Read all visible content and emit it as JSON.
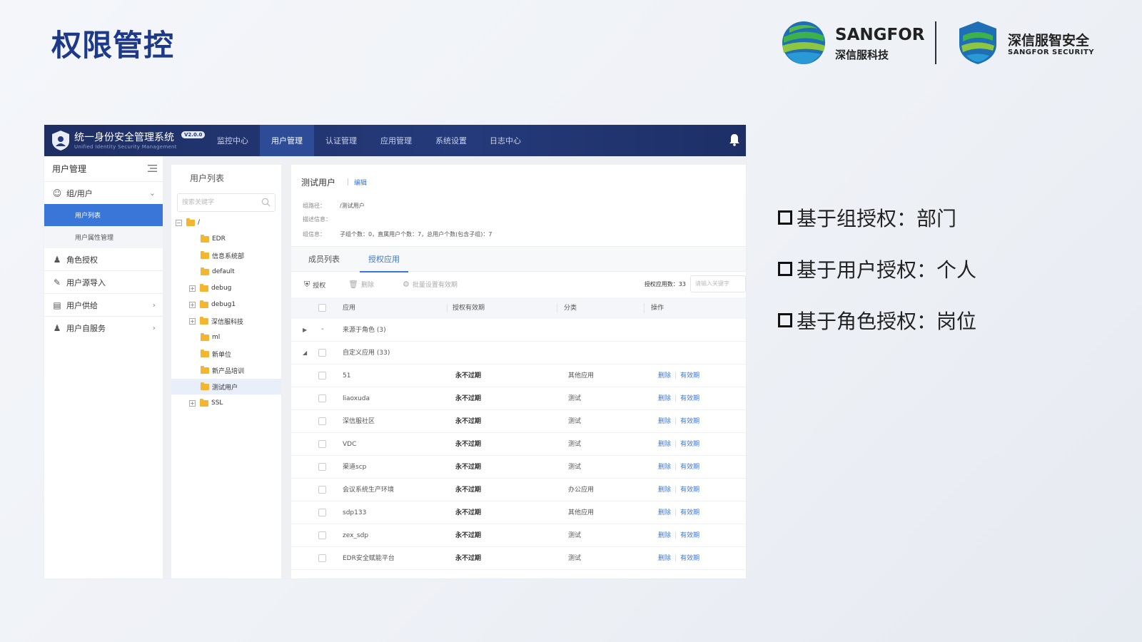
{
  "slide": {
    "title": "权限管控",
    "bullets": [
      "基于组授权：部门",
      "基于用户授权：个人",
      "基于角色授权：岗位"
    ]
  },
  "logos": {
    "sangfor_main": "SANGFOR",
    "sangfor_sub": "深信服科技",
    "security_main": "深信服智安全",
    "security_sub": "SANGFOR SECURITY"
  },
  "app": {
    "brand_title": "统一身份安全管理系统",
    "brand_subtitle": "Unified Identity Security Management",
    "version": "V2.0.0",
    "nav": [
      "监控中心",
      "用户管理",
      "认证管理",
      "应用管理",
      "系统设置",
      "日志中心"
    ],
    "active_nav_index": 1,
    "sidebar": {
      "header": "用户管理",
      "group_label": "组/用户",
      "sub_items": [
        "用户列表",
        "用户属性管理"
      ],
      "items": [
        "角色授权",
        "用户源导入",
        "用户供给",
        "用户自服务"
      ]
    },
    "tree": {
      "title": "用户列表",
      "search_placeholder": "搜索关键字",
      "root": "/",
      "nodes": [
        "EDR",
        "信息系统部",
        "default",
        "debug",
        "debug1",
        "深信服科技",
        "ml",
        "新单位",
        "新产品培训",
        "测试用户",
        "SSL"
      ]
    },
    "detail": {
      "title": "测试用户",
      "edit_label": "编辑",
      "path_label": "组路径：",
      "path_value": "/测试用户",
      "desc_label": "描述信息：",
      "info_label": "组信息：",
      "info_value": "子组个数：0，直属用户个数：7，总用户个数(包含子组)：7",
      "tabs": [
        "成员列表",
        "授权应用"
      ],
      "active_tab_index": 1
    },
    "toolbar": {
      "authorize": "授权",
      "delete": "删除",
      "batch": "批量设置有效期",
      "count_label": "授权应用数：33",
      "search_placeholder": "请输入关键字"
    },
    "table": {
      "columns": [
        "应用",
        "授权有效期",
        "分类",
        "操作"
      ],
      "groups": [
        {
          "label": "来源于角色 (3)",
          "expanded": false
        },
        {
          "label": "自定义应用 (33)",
          "expanded": true
        }
      ],
      "rows": [
        {
          "app": "51",
          "validity": "永不过期",
          "category": "其他应用"
        },
        {
          "app": "liaoxuda",
          "validity": "永不过期",
          "category": "测试"
        },
        {
          "app": "深信服社区",
          "validity": "永不过期",
          "category": "测试"
        },
        {
          "app": "VDC",
          "validity": "永不过期",
          "category": "测试"
        },
        {
          "app": "渠道scp",
          "validity": "永不过期",
          "category": "测试"
        },
        {
          "app": "会议系统生产环境",
          "validity": "永不过期",
          "category": "办公应用"
        },
        {
          "app": "sdp133",
          "validity": "永不过期",
          "category": "其他应用"
        },
        {
          "app": "zex_sdp",
          "validity": "永不过期",
          "category": "测试"
        },
        {
          "app": "EDR安全赋能平台",
          "validity": "永不过期",
          "category": "测试"
        }
      ],
      "action_delete": "删除",
      "action_validity": "有效期"
    }
  },
  "colors": {
    "title_blue": "#1d3a8a",
    "topbar": "#243a7a",
    "accent": "#3a75d8",
    "folder": "#f2b632"
  }
}
